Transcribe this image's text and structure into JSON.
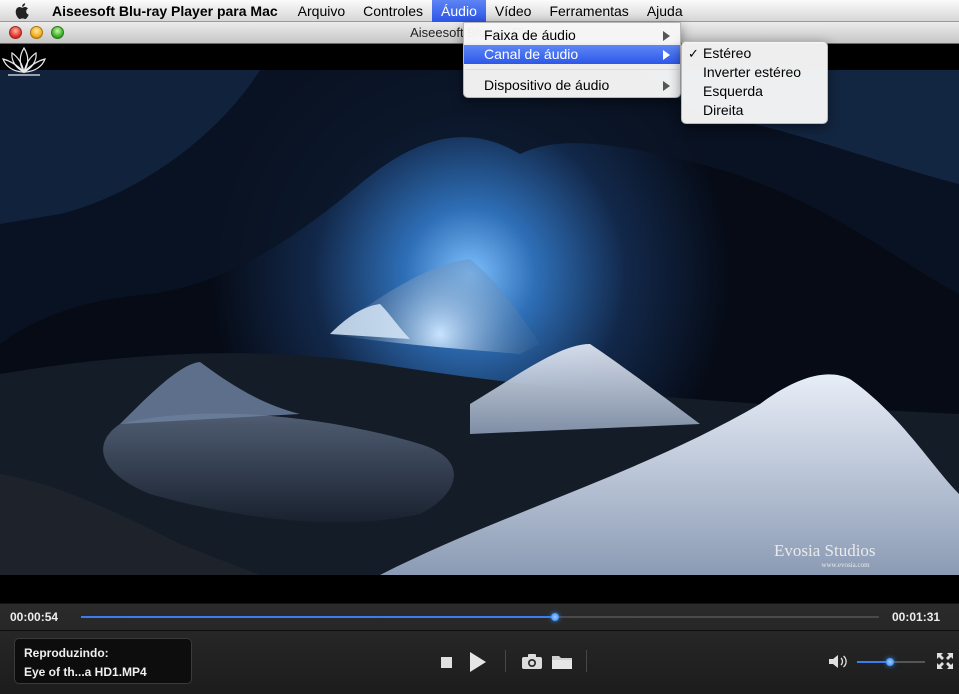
{
  "menubar": {
    "app_name": "Aiseesoft Blu-ray Player para Mac",
    "items": [
      {
        "label": "Arquivo",
        "name": "menu-arquivo"
      },
      {
        "label": "Controles",
        "name": "menu-controles"
      },
      {
        "label": "Áudio",
        "name": "menu-audio",
        "active": true
      },
      {
        "label": "Vídeo",
        "name": "menu-video"
      },
      {
        "label": "Ferramentas",
        "name": "menu-ferramentas"
      },
      {
        "label": "Ajuda",
        "name": "menu-ajuda"
      }
    ]
  },
  "window": {
    "title": "Aiseesoft Blu-ray Player"
  },
  "audio_menu": {
    "items": [
      {
        "label": "Faixa de áudio",
        "has_submenu": true,
        "highlighted": false
      },
      {
        "label": "Canal de áudio",
        "has_submenu": true,
        "highlighted": true
      },
      {
        "label": "Dispositivo de áudio",
        "has_submenu": true,
        "highlighted": false
      }
    ]
  },
  "channel_submenu": {
    "items": [
      {
        "label": "Estéreo",
        "checked": true
      },
      {
        "label": "Inverter estéreo",
        "checked": false
      },
      {
        "label": "Esquerda",
        "checked": false
      },
      {
        "label": "Direita",
        "checked": false
      }
    ],
    "check_glyph": "✓"
  },
  "video": {
    "watermark_name": "Evosia Studios",
    "watermark_url": "www.evosia.com"
  },
  "player": {
    "time_current": "00:00:54",
    "time_total": "00:01:31",
    "progress_fraction": 0.594,
    "now_playing_label": "Reproduzindo:",
    "now_playing_file": "Eye of th...a HD1.MP4",
    "volume_fraction": 0.49,
    "accent_color": "#3c7cf0"
  },
  "icons": {
    "apple": "apple-icon",
    "stop": "stop-icon",
    "play": "play-icon",
    "snapshot": "camera-icon",
    "open": "folder-icon",
    "volume": "speaker-icon",
    "fullscreen": "fullscreen-icon"
  }
}
